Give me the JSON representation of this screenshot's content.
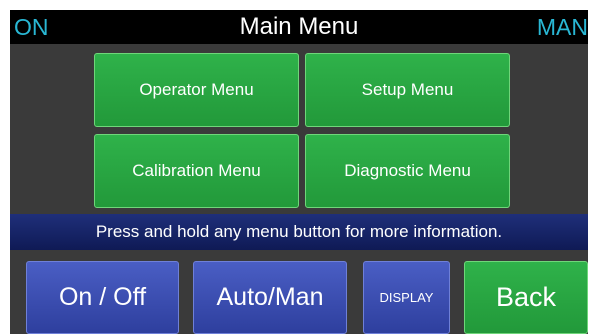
{
  "status": {
    "left": "ON",
    "right": "MAN"
  },
  "title": "Main Menu",
  "menu": {
    "operator": "Operator Menu",
    "setup": "Setup Menu",
    "calibration": "Calibration Menu",
    "diagnostic": "Diagnostic Menu"
  },
  "info": "Press and hold any menu button for more information.",
  "buttons": {
    "on_off": "On / Off",
    "auto_man": "Auto/Man",
    "display": "DISPLAY",
    "back": "Back"
  },
  "colors": {
    "status_text": "#29b7d4",
    "menu_green": "#2fb24a",
    "bottom_blue": "#3e51b5",
    "info_bar": "#1a2868",
    "background": "#3a3a3a",
    "title_bar": "#000000"
  }
}
